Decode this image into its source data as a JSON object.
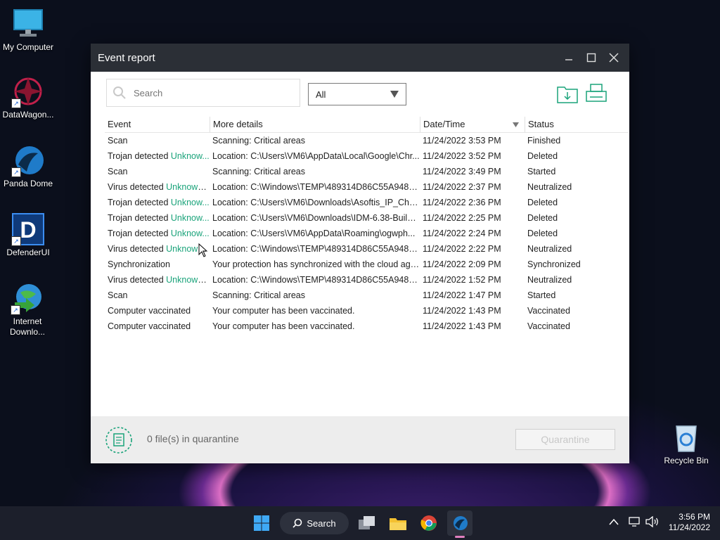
{
  "desktop": {
    "icons": [
      {
        "label": "My Computer"
      },
      {
        "label": "DataWagon..."
      },
      {
        "label": "Panda Dome"
      },
      {
        "label": "DefenderUI"
      },
      {
        "label": "Internet Downlo..."
      },
      {
        "label": "Recycle Bin"
      }
    ]
  },
  "window": {
    "title": "Event report",
    "search_placeholder": "Search",
    "filter_value": "All",
    "columns": [
      "Event",
      "More details",
      "Date/Time",
      "Status"
    ],
    "rows": [
      {
        "event": "Scan",
        "link": "",
        "details": "Scanning: Critical areas",
        "datetime": "11/24/2022 3:53 PM",
        "status": "Finished"
      },
      {
        "event": "Trojan detected ",
        "link": "Unknow...",
        "details": "Location: C:\\Users\\VM6\\AppData\\Local\\Google\\Chr...",
        "datetime": "11/24/2022 3:52 PM",
        "status": "Deleted"
      },
      {
        "event": "Scan",
        "link": "",
        "details": "Scanning: Critical areas",
        "datetime": "11/24/2022 3:49 PM",
        "status": "Started"
      },
      {
        "event": "Virus detected ",
        "link": "Unknown...",
        "details": "Location: C:\\Windows\\TEMP\\489314D86C55A948A...",
        "datetime": "11/24/2022 2:37 PM",
        "status": "Neutralized"
      },
      {
        "event": "Trojan detected ",
        "link": "Unknow...",
        "details": "Location: C:\\Users\\VM6\\Downloads\\Asoftis_IP_Cha...",
        "datetime": "11/24/2022 2:36 PM",
        "status": "Deleted"
      },
      {
        "event": "Trojan detected ",
        "link": "Unknow...",
        "details": "Location: C:\\Users\\VM6\\Downloads\\IDM-6.38-Build-...",
        "datetime": "11/24/2022 2:25 PM",
        "status": "Deleted"
      },
      {
        "event": "Trojan detected ",
        "link": "Unknow...",
        "details": "Location: C:\\Users\\VM6\\AppData\\Roaming\\ogwph...",
        "datetime": "11/24/2022 2:24 PM",
        "status": "Deleted"
      },
      {
        "event": "Virus detected ",
        "link": "Unknown...",
        "details": "Location: C:\\Windows\\TEMP\\489314D86C55A948A...",
        "datetime": "11/24/2022 2:22 PM",
        "status": "Neutralized"
      },
      {
        "event": "Synchronization",
        "link": "",
        "details": "Your protection has synchronized with the cloud aga...",
        "datetime": "11/24/2022 2:09 PM",
        "status": "Synchronized"
      },
      {
        "event": "Virus detected ",
        "link": "Unknown...",
        "details": "Location: C:\\Windows\\TEMP\\489314D86C55A948A...",
        "datetime": "11/24/2022 1:52 PM",
        "status": "Neutralized"
      },
      {
        "event": "Scan",
        "link": "",
        "details": "Scanning: Critical areas",
        "datetime": "11/24/2022 1:47 PM",
        "status": "Started"
      },
      {
        "event": "Computer vaccinated",
        "link": "",
        "details": "Your computer has been vaccinated.",
        "datetime": "11/24/2022 1:43 PM",
        "status": "Vaccinated"
      },
      {
        "event": "Computer vaccinated",
        "link": "",
        "details": "Your computer has been vaccinated.",
        "datetime": "11/24/2022 1:43 PM",
        "status": "Vaccinated"
      }
    ],
    "quarantine_text": "0 file(s) in quarantine",
    "quarantine_button": "Quarantine"
  },
  "taskbar": {
    "search_label": "Search",
    "time": "3:56 PM",
    "date": "11/24/2022"
  },
  "colors": {
    "accent": "#1aa37a",
    "titlebar": "#2b2f36",
    "taskbar": "#1c1f2b"
  }
}
